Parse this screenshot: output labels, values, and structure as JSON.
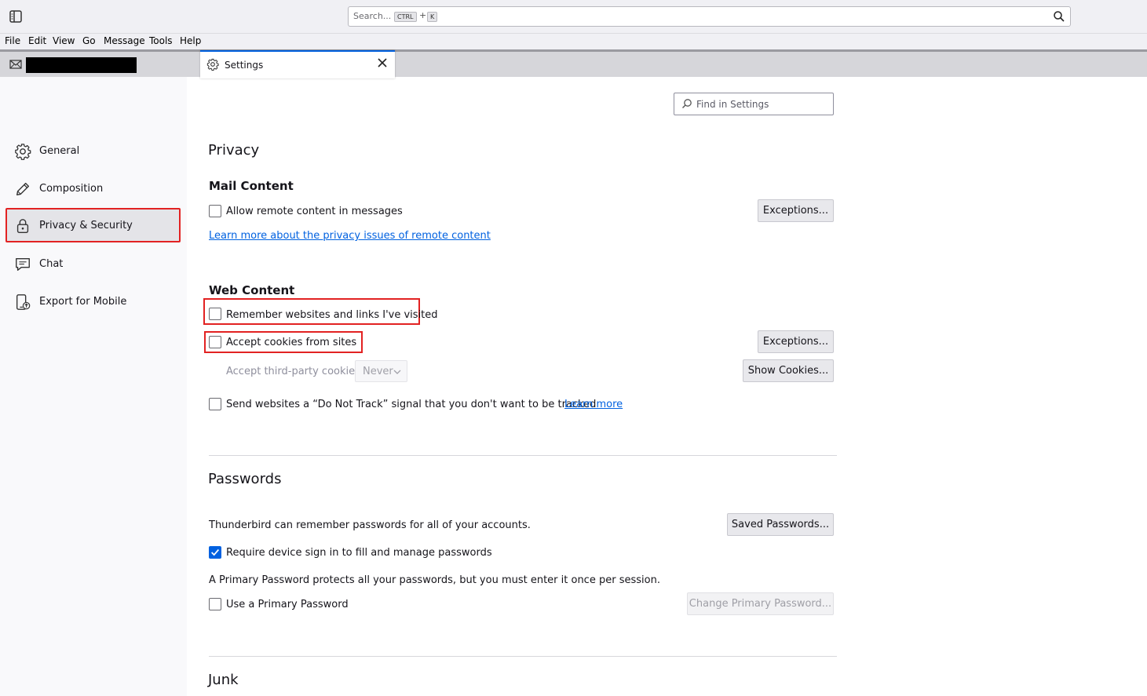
{
  "search": {
    "placeholder": "Search...",
    "kbd_ctrl": "CTRL",
    "kbd_plus": "+",
    "kbd_k": "K"
  },
  "menubar": [
    "File",
    "Edit",
    "View",
    "Go",
    "Message",
    "Tools",
    "Help"
  ],
  "tabs": {
    "settings_label": "Settings"
  },
  "sidebar": {
    "items": [
      {
        "label": "General",
        "icon": "gear-icon"
      },
      {
        "label": "Composition",
        "icon": "pencil-icon"
      },
      {
        "label": "Privacy & Security",
        "icon": "lock-icon",
        "selected": true
      },
      {
        "label": "Chat",
        "icon": "chat-icon"
      },
      {
        "label": "Export for Mobile",
        "icon": "mobile-export-icon"
      }
    ]
  },
  "find": {
    "placeholder": "Find in Settings"
  },
  "privacy": {
    "heading": "Privacy",
    "mail_content": {
      "heading": "Mail Content",
      "allow_remote_label": "Allow remote content in messages",
      "allow_remote_checked": false,
      "exceptions_label": "Exceptions...",
      "learn_more_link": "Learn more about the privacy issues of remote content"
    },
    "web_content": {
      "heading": "Web Content",
      "remember_label": "Remember websites and links I've visited",
      "remember_checked": false,
      "cookies_label": "Accept cookies from sites",
      "cookies_checked": false,
      "exceptions_label": "Exceptions...",
      "third_party_label": "Accept third-party cookies:",
      "third_party_value": "Never",
      "show_cookies_label": "Show Cookies...",
      "dnt_label": "Send websites a “Do Not Track” signal that you don't want to be tracked",
      "dnt_checked": false,
      "dnt_learn_more": "Learn more"
    }
  },
  "passwords": {
    "heading": "Passwords",
    "remember_text": "Thunderbird can remember passwords for all of your accounts.",
    "saved_passwords_label": "Saved Passwords...",
    "require_sign_in_label": "Require device sign in to fill and manage passwords",
    "require_sign_in_checked": true,
    "primary_info": "A Primary Password protects all your passwords, but you must enter it once per session.",
    "use_primary_label": "Use a Primary Password",
    "use_primary_checked": false,
    "change_primary_label": "Change Primary Password..."
  },
  "junk": {
    "heading": "Junk"
  },
  "colors": {
    "accent": "#0061e0",
    "highlight": "#e22222",
    "tab_active_border": "#0060df"
  }
}
